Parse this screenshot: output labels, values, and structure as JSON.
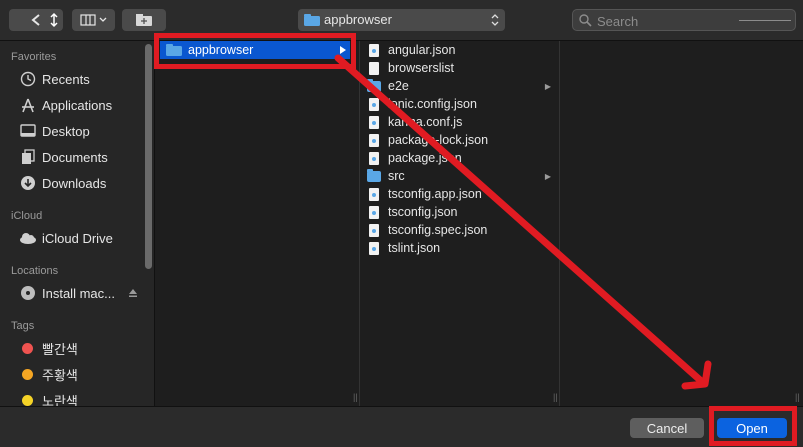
{
  "toolbar": {
    "view_icon": "column-view-icon",
    "new_folder_icon": "new-folder-icon",
    "path_label": "appbrowser",
    "search_placeholder": "Search"
  },
  "sidebar": {
    "favorites_header": "Favorites",
    "favorites": [
      {
        "label": "Recents",
        "icon": "clock-icon"
      },
      {
        "label": "Applications",
        "icon": "applications-icon"
      },
      {
        "label": "Desktop",
        "icon": "desktop-icon"
      },
      {
        "label": "Documents",
        "icon": "document-icon"
      },
      {
        "label": "Downloads",
        "icon": "download-icon"
      }
    ],
    "icloud_header": "iCloud",
    "icloud": [
      {
        "label": "iCloud Drive",
        "icon": "cloud-icon"
      }
    ],
    "locations_header": "Locations",
    "locations": [
      {
        "label": "Install mac...",
        "icon": "disk-icon"
      }
    ],
    "tags_header": "Tags",
    "tags": [
      {
        "label": "빨간색",
        "color": "#ef5350"
      },
      {
        "label": "주황색",
        "color": "#f6a623"
      },
      {
        "label": "노란색",
        "color": "#f5d327"
      }
    ]
  },
  "column1": {
    "selected": "appbrowser"
  },
  "column2": {
    "items": [
      {
        "label": "angular.json",
        "kind": "json"
      },
      {
        "label": "browserslist",
        "kind": "doc"
      },
      {
        "label": "e2e",
        "kind": "folder"
      },
      {
        "label": "ionic.config.json",
        "kind": "json"
      },
      {
        "label": "karma.conf.js",
        "kind": "json"
      },
      {
        "label": "package-lock.json",
        "kind": "json"
      },
      {
        "label": "package.json",
        "kind": "json"
      },
      {
        "label": "src",
        "kind": "folder"
      },
      {
        "label": "tsconfig.app.json",
        "kind": "json"
      },
      {
        "label": "tsconfig.json",
        "kind": "json"
      },
      {
        "label": "tsconfig.spec.json",
        "kind": "json"
      },
      {
        "label": "tslint.json",
        "kind": "json"
      }
    ]
  },
  "buttons": {
    "cancel": "Cancel",
    "open": "Open"
  },
  "colors": {
    "accent": "#0b63e0",
    "annotation": "#e01b22"
  }
}
